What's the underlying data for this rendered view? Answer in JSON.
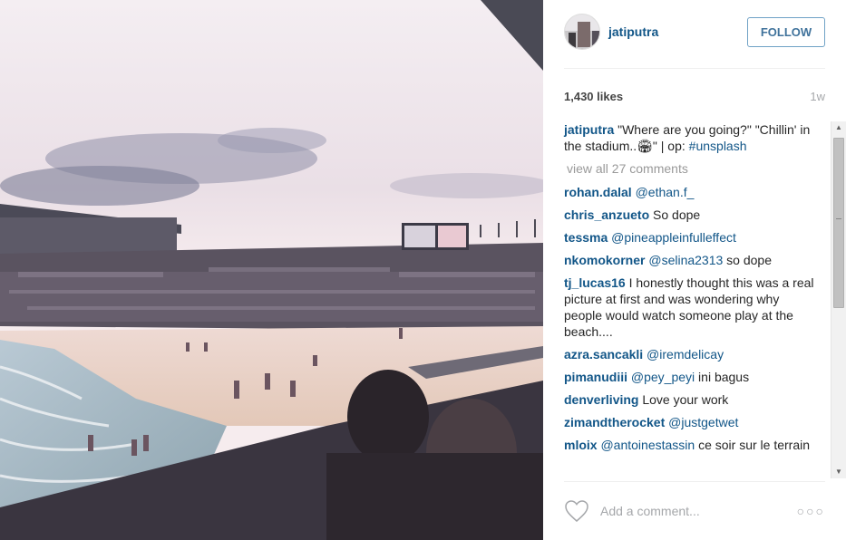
{
  "header": {
    "username": "jatiputra",
    "follow_label": "FOLLOW"
  },
  "stats": {
    "likes": "1,430 likes",
    "time": "1w"
  },
  "caption": {
    "user": "jatiputra",
    "text": " \"Where are you going?\" \"Chillin' in the stadium..🏟\" | op: ",
    "hashtag": "#unsplash"
  },
  "view_all": "view all 27 comments",
  "comments": [
    {
      "user": "rohan.dalal",
      "mention": " @ethan.f_",
      "text": ""
    },
    {
      "user": "chris_anzueto",
      "mention": "",
      "text": " So dope"
    },
    {
      "user": "tessma",
      "mention": " @pineappleinfulleffect",
      "text": ""
    },
    {
      "user": "nkomokorner",
      "mention": " @selina2313",
      "text": " so dope"
    },
    {
      "user": "tj_lucas16",
      "mention": "",
      "text": " I honestly thought this was a real picture at first and was wondering why people would watch someone play at the beach...."
    },
    {
      "user": "azra.sancakli",
      "mention": " @iremdelicay",
      "text": ""
    },
    {
      "user": "pimanudiii",
      "mention": " @pey_peyi",
      "text": " ini bagus"
    },
    {
      "user": "denverliving",
      "mention": "",
      "text": " Love your work"
    },
    {
      "user": "zimandtherocket",
      "mention": " @justgetwet",
      "text": ""
    },
    {
      "user": "mloix",
      "mention": " @antoinestassin",
      "text": " ce soir sur le terrain"
    }
  ],
  "footer": {
    "add_comment_placeholder": "Add a comment...",
    "more_label": "○○○"
  },
  "colors": {
    "link": "#125688",
    "follow_border": "#70a2c6",
    "muted": "#a5a7aa"
  }
}
